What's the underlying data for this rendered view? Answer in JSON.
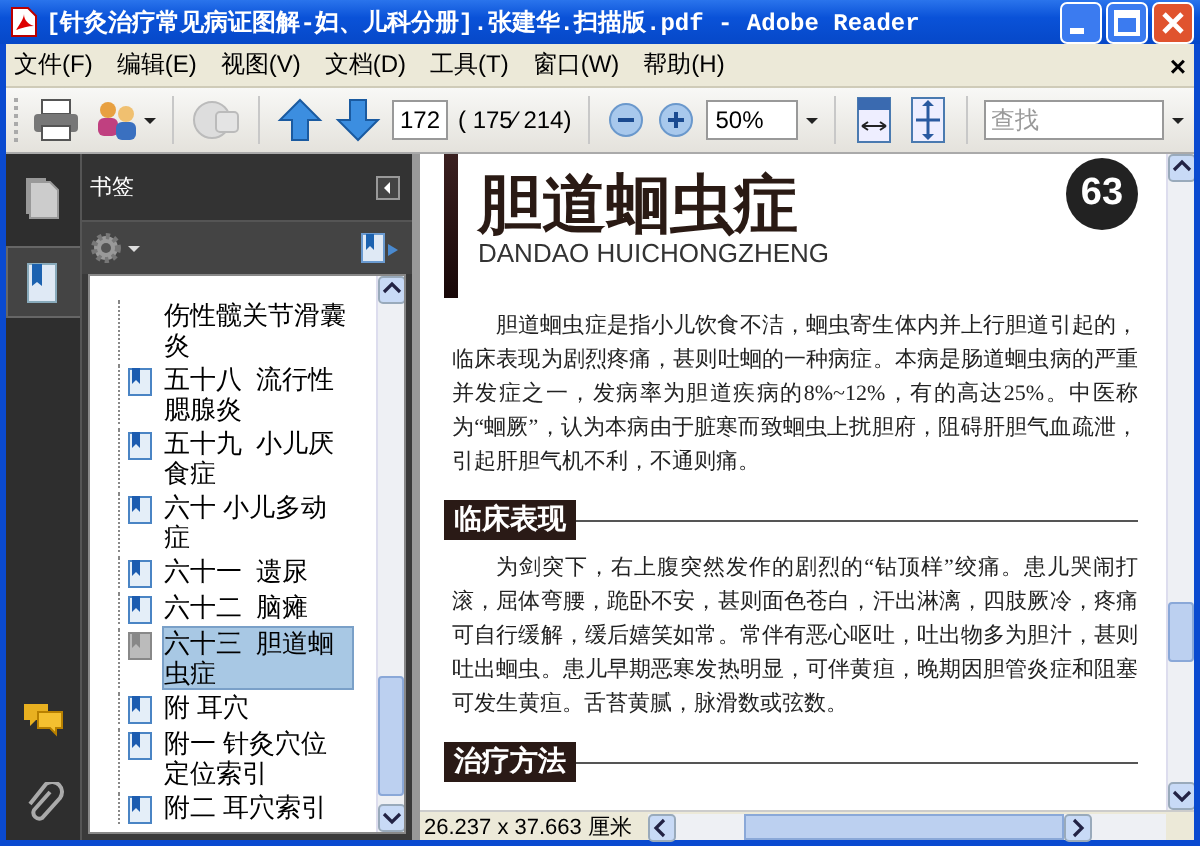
{
  "window": {
    "title": "[针灸治疗常见病证图解-妇、儿科分册].张建华.扫描版.pdf - Adobe Reader"
  },
  "menu": [
    "文件(F)",
    "编辑(E)",
    "视图(V)",
    "文档(D)",
    "工具(T)",
    "窗口(W)",
    "帮助(H)"
  ],
  "menu_close": "×",
  "toolbar": {
    "page_field": "172",
    "page_count": "( 175⁄ 214)",
    "zoom": "50%",
    "search": {
      "placeholder": "查找"
    }
  },
  "nav_tabs": [
    {
      "kind": "pages",
      "selected": false
    },
    {
      "kind": "bookmarks",
      "selected": true
    },
    {
      "kind": "comments",
      "selected": false
    },
    {
      "kind": "attachments",
      "selected": false
    }
  ],
  "bookmarks": {
    "title": "书签",
    "items": [
      {
        "label": "伤性髋关节滑囊炎",
        "kind": "continued",
        "selected": false
      },
      {
        "label": "五十八  流行性腮腺炎",
        "kind": "bookmark",
        "selected": false
      },
      {
        "label": "五十九  小儿厌食症",
        "kind": "bookmark",
        "selected": false
      },
      {
        "label": "六十 小儿多动症",
        "kind": "bookmark",
        "selected": false
      },
      {
        "label": "六十一  遗尿",
        "kind": "bookmark",
        "selected": false
      },
      {
        "label": "六十二  脑瘫",
        "kind": "bookmark",
        "selected": false
      },
      {
        "label": "六十三  胆道蛔虫症",
        "kind": "bookmark",
        "selected": true
      },
      {
        "label": "附 耳穴",
        "kind": "bookmark",
        "selected": false
      },
      {
        "label": "附一 针灸穴位定位索引",
        "kind": "bookmark",
        "selected": false
      },
      {
        "label": "附二 耳穴索引",
        "kind": "bookmark",
        "selected": false
      }
    ]
  },
  "document": {
    "badge": "63",
    "title": "胆道蛔虫症",
    "subtitle": "DANDAO HUICHONGZHENG",
    "intro": "胆道蛔虫症是指小儿饮食不洁，蛔虫寄生体内并上行胆道引起的，临床表现为剧烈疼痛，甚则吐蛔的一种病症。本病是肠道蛔虫病的严重并发症之一，发病率为胆道疾病的8%~12%，有的高达25%。中医称为“蛔厥”，认为本病由于脏寒而致蛔虫上扰胆府，阻碍肝胆气血疏泄，引起肝胆气机不利，不通则痛。",
    "sections": [
      {
        "heading": "临床表现",
        "text": "为剑突下，右上腹突然发作的剧烈的“钻顶样”绞痛。患儿哭闹打滚，屈体弯腰，跪卧不安，甚则面色苍白，汗出淋漓，四肢厥冷，疼痛可自行缓解，缓后嬉笑如常。常伴有恶心呕吐，吐出物多为胆汁，甚则吐出蛔虫。患儿早期恶寒发热明显，可伴黄疸，晚期因胆管炎症和阻塞可发生黄疸。舌苔黄腻，脉滑数或弦数。"
      },
      {
        "heading": "治疗方法"
      }
    ]
  },
  "status_bar": {
    "page_size": "26.237 x 37.663 厘米"
  }
}
